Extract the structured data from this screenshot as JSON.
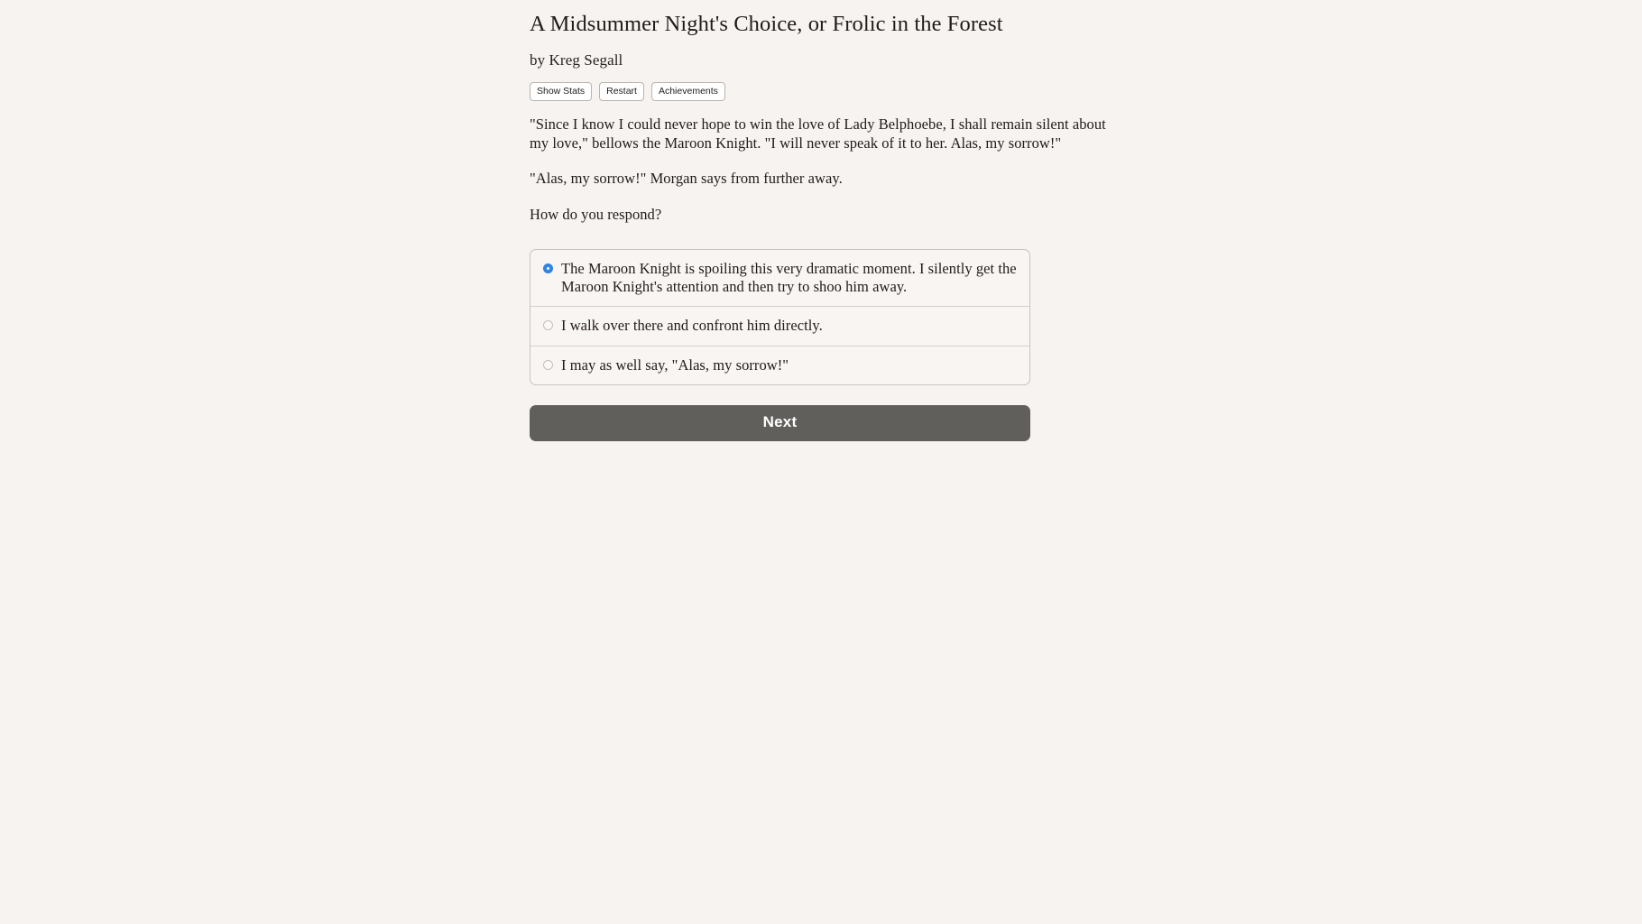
{
  "page": {
    "background_color": "#f7f3f0",
    "text_color": "#201c1a"
  },
  "header": {
    "title": "A Midsummer Night's Choice, or Frolic in the Forest",
    "byline": "by Kreg Segall"
  },
  "toolbar": {
    "show_stats_label": "Show Stats",
    "restart_label": "Restart",
    "achievements_label": "Achievements"
  },
  "story": {
    "paragraphs": [
      "\"Since I know I could never hope to win the love of Lady Belphoebe, I shall remain silent about my love,\" bellows the Maroon Knight. \"I will never speak of it to her. Alas, my sorrow!\"",
      "\"Alas, my sorrow!\" Morgan says from further away."
    ],
    "prompt": "How do you respond?"
  },
  "choices": {
    "selected_index": 0,
    "selected_color": "#2f86e8",
    "options": [
      {
        "label": "The Maroon Knight is spoiling this very dramatic moment. I silently get the Maroon Knight's attention and then try to shoo him away.",
        "selected": true
      },
      {
        "label": "I walk over there and confront him directly.",
        "selected": false
      },
      {
        "label": "I may as well say, \"Alas, my sorrow!\"",
        "selected": false
      }
    ]
  },
  "footer": {
    "next_label": "Next",
    "next_color": "#615f5c"
  }
}
